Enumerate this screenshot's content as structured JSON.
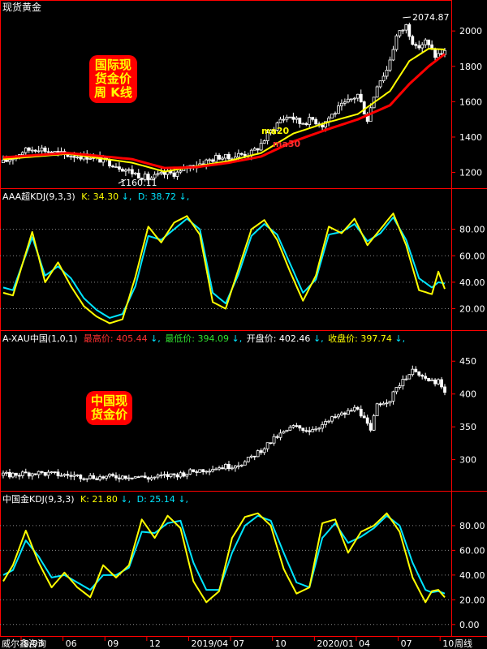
{
  "colors": {
    "background": "#000000",
    "frame": "#ff0000",
    "text": "#ffffff",
    "k_line": "#ffff00",
    "d_line": "#00e5ff",
    "ma20": "#ffff00",
    "ma30": "#ff0000",
    "high": "#ff3030",
    "low": "#30e030",
    "close": "#ffff00",
    "candle": "#ffffff"
  },
  "panel1": {
    "title": "现货黄金",
    "badge": [
      "国际现",
      "货金价",
      "周 K线"
    ],
    "max_label": "2074.87",
    "min_label": "1160.11",
    "ma20_label": "ma20",
    "ma30_label": "ma30"
  },
  "panel2": {
    "name": "AAA超KDJ(9,3,3)",
    "k_label": "K: 34.30",
    "d_label": "D: 38.72",
    "arrow": "↓,"
  },
  "panel3": {
    "name": "A-XAU中国(1,0,1)",
    "high_label": "最高价: 405.44",
    "low_label": "最低价: 394.09",
    "open_label": "开盘价: 402.46",
    "close_label": "收盘价: 397.74",
    "arrow": "↓,",
    "badge": [
      "中国现",
      "货金价"
    ]
  },
  "panel4": {
    "name": "中国金KDJ(9,3,3)",
    "k_label": "K: 21.80",
    "d_label": "D: 25.14",
    "arrow": "↓,"
  },
  "xaxis": {
    "source": "威尔鑫咨询",
    "ticks": [
      "8/03",
      "06",
      "09",
      "12",
      "2019/04",
      "07",
      "10",
      "2020/01",
      "04",
      "07",
      "10"
    ],
    "period": "周线"
  },
  "chart_data": [
    {
      "type": "candlestick",
      "title": "现货黄金",
      "ylim": [
        1120,
        2120
      ],
      "yticks": [
        1200,
        1400,
        1600,
        1800,
        2000
      ],
      "x_start": "2018/03",
      "x_end": "2020/12",
      "anchors_x": [
        0,
        6,
        11,
        14,
        19,
        27,
        34,
        40,
        45,
        50,
        55,
        57,
        61,
        67,
        70,
        73,
        77,
        79,
        82,
        86,
        89,
        92,
        96,
        99,
        101,
        104,
        107,
        110,
        113,
        116,
        119,
        122,
        125,
        128,
        131,
        134,
        137
      ],
      "anchors_close": [
        1255,
        1320,
        1340,
        1320,
        1300,
        1290,
        1250,
        1200,
        1165,
        1190,
        1200,
        1230,
        1250,
        1290,
        1280,
        1300,
        1310,
        1340,
        1410,
        1500,
        1520,
        1480,
        1500,
        1470,
        1510,
        1560,
        1600,
        1640,
        1500,
        1700,
        1780,
        1970,
        2030,
        1900,
        1940,
        1860,
        1880
      ],
      "series": [
        {
          "name": "ma20",
          "anchors_x": [
            0,
            20,
            40,
            50,
            60,
            70,
            80,
            90,
            100,
            110,
            120,
            126,
            132,
            137
          ],
          "values": [
            1275,
            1305,
            1255,
            1205,
            1235,
            1265,
            1310,
            1420,
            1480,
            1530,
            1660,
            1830,
            1900,
            1895
          ]
        },
        {
          "name": "ma30",
          "anchors_x": [
            0,
            20,
            40,
            50,
            60,
            70,
            80,
            90,
            100,
            110,
            120,
            126,
            132,
            137
          ],
          "values": [
            1285,
            1310,
            1275,
            1225,
            1230,
            1255,
            1290,
            1375,
            1440,
            1500,
            1580,
            1700,
            1800,
            1870
          ]
        }
      ],
      "max": {
        "value": 2074.87,
        "x": 124
      },
      "min": {
        "value": 1160.11,
        "x": 38
      }
    },
    {
      "type": "line",
      "title": "AAA超KDJ(9,3,3)",
      "ylim": [
        5,
        100
      ],
      "yticks": [
        20,
        40,
        60,
        80
      ],
      "series": [
        {
          "name": "K",
          "anchors_x": [
            0,
            3,
            9,
            13,
            17,
            21,
            25,
            29,
            33,
            37,
            41,
            45,
            49,
            53,
            57,
            61,
            65,
            69,
            73,
            77,
            81,
            85,
            89,
            93,
            97,
            101,
            105,
            109,
            113,
            117,
            121,
            125,
            129,
            133,
            135,
            137
          ],
          "values": [
            32,
            30,
            78,
            40,
            55,
            37,
            22,
            14,
            9,
            12,
            44,
            82,
            70,
            85,
            90,
            76,
            25,
            20,
            50,
            80,
            87,
            72,
            48,
            26,
            45,
            82,
            77,
            88,
            68,
            80,
            92,
            68,
            34,
            31,
            48,
            35
          ]
        },
        {
          "name": "D",
          "anchors_x": [
            0,
            3,
            9,
            13,
            17,
            21,
            25,
            29,
            33,
            37,
            41,
            45,
            49,
            53,
            57,
            61,
            65,
            69,
            73,
            77,
            81,
            85,
            89,
            93,
            97,
            101,
            105,
            109,
            113,
            117,
            121,
            125,
            129,
            133,
            135,
            137
          ],
          "values": [
            36,
            34,
            74,
            45,
            52,
            43,
            28,
            19,
            13,
            16,
            37,
            75,
            72,
            80,
            88,
            80,
            32,
            24,
            46,
            75,
            84,
            76,
            54,
            32,
            42,
            76,
            78,
            84,
            71,
            77,
            89,
            72,
            43,
            36,
            40,
            39
          ]
        }
      ]
    },
    {
      "type": "candlestick",
      "title": "A-XAU中国(1,0,1)",
      "ylim": [
        255,
        475
      ],
      "yticks": [
        300,
        350,
        400,
        450
      ],
      "anchors_x": [
        0,
        10,
        20,
        30,
        40,
        45,
        50,
        55,
        60,
        65,
        70,
        75,
        80,
        85,
        90,
        95,
        100,
        103,
        106,
        110,
        114,
        116,
        120,
        124,
        128,
        131,
        135,
        137
      ],
      "anchors_close": [
        276,
        280,
        276,
        273,
        275,
        272,
        275,
        278,
        283,
        287,
        290,
        296,
        315,
        335,
        350,
        345,
        355,
        365,
        370,
        380,
        342,
        385,
        392,
        423,
        438,
        420,
        418,
        400
      ]
    },
    {
      "type": "line",
      "title": "中国金KDJ(9,3,3)",
      "ylim": [
        -8,
        97
      ],
      "yticks": [
        0,
        20,
        40,
        60,
        80
      ],
      "series": [
        {
          "name": "K",
          "anchors_x": [
            0,
            3,
            7,
            11,
            15,
            19,
            23,
            27,
            31,
            35,
            39,
            43,
            47,
            51,
            55,
            59,
            63,
            67,
            71,
            75,
            79,
            83,
            87,
            91,
            95,
            99,
            103,
            107,
            111,
            115,
            119,
            123,
            127,
            131,
            133,
            135,
            137
          ],
          "values": [
            35,
            48,
            76,
            50,
            30,
            42,
            30,
            22,
            48,
            38,
            48,
            85,
            70,
            88,
            78,
            35,
            18,
            27,
            70,
            87,
            90,
            80,
            45,
            25,
            30,
            82,
            85,
            58,
            75,
            80,
            90,
            75,
            38,
            18,
            27,
            28,
            22
          ]
        },
        {
          "name": "D",
          "anchors_x": [
            0,
            3,
            7,
            11,
            15,
            19,
            23,
            27,
            31,
            35,
            39,
            43,
            47,
            51,
            55,
            59,
            63,
            67,
            71,
            75,
            79,
            83,
            87,
            91,
            95,
            99,
            103,
            107,
            111,
            115,
            119,
            123,
            127,
            131,
            133,
            135,
            137
          ],
          "values": [
            40,
            44,
            68,
            55,
            38,
            40,
            34,
            28,
            40,
            40,
            46,
            75,
            74,
            82,
            84,
            50,
            28,
            28,
            58,
            80,
            88,
            84,
            58,
            34,
            30,
            70,
            82,
            66,
            71,
            78,
            88,
            80,
            50,
            28,
            26,
            27,
            25
          ]
        }
      ]
    }
  ]
}
